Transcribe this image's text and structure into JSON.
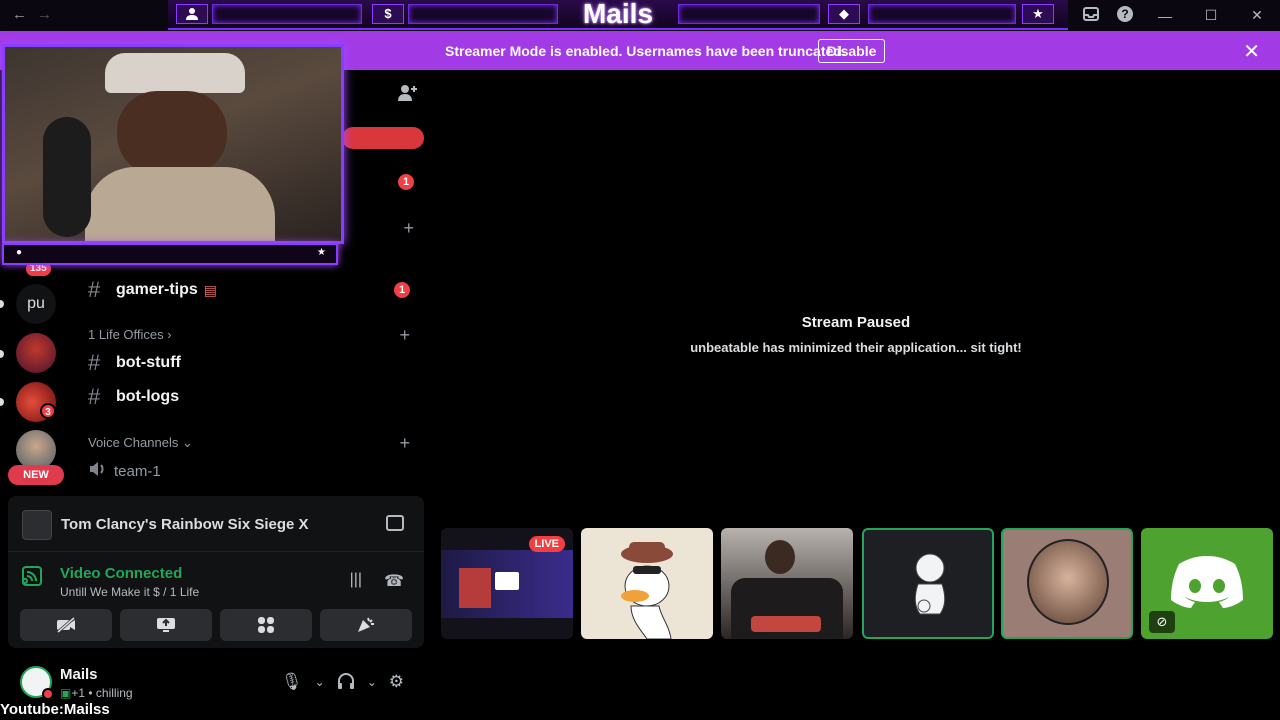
{
  "titlebar": {
    "overlay_title": "Mails",
    "overlay_icons": [
      "person",
      "$",
      "◆",
      "★"
    ]
  },
  "banner": {
    "text": "Streamer Mode is enabled. Usernames have been truncated.",
    "button": "Disable"
  },
  "rail": {
    "items": [
      {
        "label": "135",
        "type": "badge"
      },
      {
        "label": "pu",
        "type": "text"
      },
      {
        "label": "3",
        "type": "badge"
      },
      {
        "label": "NEW",
        "type": "pill"
      }
    ]
  },
  "channels": {
    "items": [
      {
        "name": "gamer-tips",
        "badge": "1"
      },
      {
        "name": "bot-stuff"
      },
      {
        "name": "bot-logs"
      }
    ],
    "categories": [
      "1 Life Offices",
      "Voice Channels"
    ],
    "voice_channel": "team-1",
    "top_badge": "1"
  },
  "voice_panel": {
    "game": "Tom Clancy's Rainbow Six Siege X",
    "status": "Video Connected",
    "channel": "Untill We Make it $ / 1 Life"
  },
  "user": {
    "name": "Mails",
    "status": "+1 • chilling"
  },
  "stream": {
    "title": "Stream Paused",
    "subtitle": "unbeatable has minimized their application... sit tight!"
  },
  "tiles": [
    {
      "kind": "screen",
      "live_label": "LIVE"
    },
    {
      "kind": "avatar-duck"
    },
    {
      "kind": "camera"
    },
    {
      "kind": "avatar-figure"
    },
    {
      "kind": "avatar-photo"
    },
    {
      "kind": "discord-logo"
    }
  ],
  "watermark": "Youtube:Mailss",
  "colors": {
    "accent": "#a23ae6",
    "overlay_purple": "#8b3dff",
    "connected_green": "#23a55a",
    "badge_red": "#f23f43"
  }
}
